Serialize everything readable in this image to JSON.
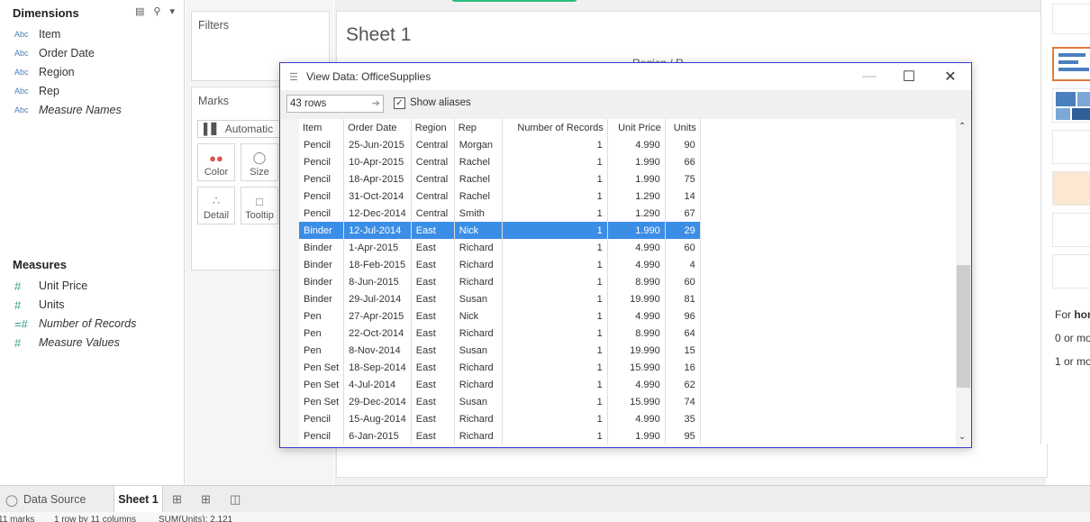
{
  "data_pane": {
    "dimensions_header": "Dimensions",
    "dimensions": [
      {
        "type": "Abc",
        "label": "Item"
      },
      {
        "type": "Abc",
        "label": "Order Date"
      },
      {
        "type": "Abc",
        "label": "Region"
      },
      {
        "type": "Abc",
        "label": "Rep"
      },
      {
        "type": "Abc",
        "label": "Measure Names"
      }
    ],
    "measures_header": "Measures",
    "measures": [
      {
        "type": "#",
        "label": "Unit Price"
      },
      {
        "type": "#",
        "label": "Units"
      },
      {
        "type": "=#",
        "label": "Number of Records"
      },
      {
        "type": "#",
        "label": "Measure Values"
      }
    ]
  },
  "shelves": {
    "filters_title": "Filters",
    "marks_title": "Marks",
    "mark_type": "Automatic",
    "buttons": {
      "color": "Color",
      "size": "Size",
      "detail": "Detail",
      "tooltip": "Tooltip"
    }
  },
  "sheet": {
    "title": "Sheet 1",
    "partial_header": "Region / R"
  },
  "dialog": {
    "title": "View Data:  OfficeSupplies",
    "rows": "43 rows",
    "show_aliases_label": "Show aliases",
    "show_aliases_checked": true,
    "columns": [
      "Item",
      "Order Date",
      "Region",
      "Rep",
      "Number of Records",
      "Unit Price",
      "Units"
    ],
    "rows_data": [
      [
        "Pencil",
        "25-Jun-2015",
        "Central",
        "Morgan",
        "1",
        "4.990",
        "90"
      ],
      [
        "Pencil",
        "10-Apr-2015",
        "Central",
        "Rachel",
        "1",
        "1.990",
        "66"
      ],
      [
        "Pencil",
        "18-Apr-2015",
        "Central",
        "Rachel",
        "1",
        "1.990",
        "75"
      ],
      [
        "Pencil",
        "31-Oct-2014",
        "Central",
        "Rachel",
        "1",
        "1.290",
        "14"
      ],
      [
        "Pencil",
        "12-Dec-2014",
        "Central",
        "Smith",
        "1",
        "1.290",
        "67"
      ],
      [
        "Binder",
        "12-Jul-2014",
        "East",
        "Nick",
        "1",
        "1.990",
        "29"
      ],
      [
        "Binder",
        "1-Apr-2015",
        "East",
        "Richard",
        "1",
        "4.990",
        "60"
      ],
      [
        "Binder",
        "18-Feb-2015",
        "East",
        "Richard",
        "1",
        "4.990",
        "4"
      ],
      [
        "Binder",
        "8-Jun-2015",
        "East",
        "Richard",
        "1",
        "8.990",
        "60"
      ],
      [
        "Binder",
        "29-Jul-2014",
        "East",
        "Susan",
        "1",
        "19.990",
        "81"
      ],
      [
        "Pen",
        "27-Apr-2015",
        "East",
        "Nick",
        "1",
        "4.990",
        "96"
      ],
      [
        "Pen",
        "22-Oct-2014",
        "East",
        "Richard",
        "1",
        "8.990",
        "64"
      ],
      [
        "Pen",
        "8-Nov-2014",
        "East",
        "Susan",
        "1",
        "19.990",
        "15"
      ],
      [
        "Pen Set",
        "18-Sep-2014",
        "East",
        "Richard",
        "1",
        "15.990",
        "16"
      ],
      [
        "Pen Set",
        "4-Jul-2014",
        "East",
        "Richard",
        "1",
        "4.990",
        "62"
      ],
      [
        "Pen Set",
        "29-Dec-2014",
        "East",
        "Susan",
        "1",
        "15.990",
        "74"
      ],
      [
        "Pencil",
        "15-Aug-2014",
        "East",
        "Richard",
        "1",
        "4.990",
        "35"
      ],
      [
        "Pencil",
        "6-Jan-2015",
        "East",
        "Richard",
        "1",
        "1.990",
        "95"
      ]
    ],
    "selected_row_index": 5
  },
  "showme": {
    "for_label": "For ",
    "for_bold": "hor",
    "line1": "0 or mo",
    "line2": "1 or mo"
  },
  "tabs": {
    "data_source": "Data Source",
    "sheet1": "Sheet 1"
  },
  "status": {
    "marks": "11 marks",
    "rows": "1 row by 11 columns",
    "sum": "SUM(Units): 2,121"
  },
  "colors": {
    "accent_green": "#2bbd7e",
    "selection_blue": "#3b8ee6",
    "showme_selected": "#e07a3a",
    "dialog_border": "#3a3ad0"
  }
}
